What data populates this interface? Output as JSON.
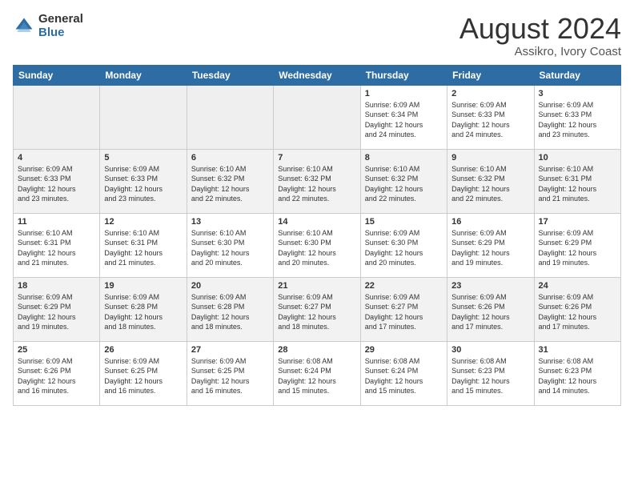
{
  "header": {
    "logo_general": "General",
    "logo_blue": "Blue",
    "month_year": "August 2024",
    "location": "Assikro, Ivory Coast"
  },
  "days_of_week": [
    "Sunday",
    "Monday",
    "Tuesday",
    "Wednesday",
    "Thursday",
    "Friday",
    "Saturday"
  ],
  "weeks": [
    [
      {
        "day": "",
        "info": ""
      },
      {
        "day": "",
        "info": ""
      },
      {
        "day": "",
        "info": ""
      },
      {
        "day": "",
        "info": ""
      },
      {
        "day": "1",
        "info": "Sunrise: 6:09 AM\nSunset: 6:34 PM\nDaylight: 12 hours\nand 24 minutes."
      },
      {
        "day": "2",
        "info": "Sunrise: 6:09 AM\nSunset: 6:33 PM\nDaylight: 12 hours\nand 24 minutes."
      },
      {
        "day": "3",
        "info": "Sunrise: 6:09 AM\nSunset: 6:33 PM\nDaylight: 12 hours\nand 23 minutes."
      }
    ],
    [
      {
        "day": "4",
        "info": "Sunrise: 6:09 AM\nSunset: 6:33 PM\nDaylight: 12 hours\nand 23 minutes."
      },
      {
        "day": "5",
        "info": "Sunrise: 6:09 AM\nSunset: 6:33 PM\nDaylight: 12 hours\nand 23 minutes."
      },
      {
        "day": "6",
        "info": "Sunrise: 6:10 AM\nSunset: 6:32 PM\nDaylight: 12 hours\nand 22 minutes."
      },
      {
        "day": "7",
        "info": "Sunrise: 6:10 AM\nSunset: 6:32 PM\nDaylight: 12 hours\nand 22 minutes."
      },
      {
        "day": "8",
        "info": "Sunrise: 6:10 AM\nSunset: 6:32 PM\nDaylight: 12 hours\nand 22 minutes."
      },
      {
        "day": "9",
        "info": "Sunrise: 6:10 AM\nSunset: 6:32 PM\nDaylight: 12 hours\nand 22 minutes."
      },
      {
        "day": "10",
        "info": "Sunrise: 6:10 AM\nSunset: 6:31 PM\nDaylight: 12 hours\nand 21 minutes."
      }
    ],
    [
      {
        "day": "11",
        "info": "Sunrise: 6:10 AM\nSunset: 6:31 PM\nDaylight: 12 hours\nand 21 minutes."
      },
      {
        "day": "12",
        "info": "Sunrise: 6:10 AM\nSunset: 6:31 PM\nDaylight: 12 hours\nand 21 minutes."
      },
      {
        "day": "13",
        "info": "Sunrise: 6:10 AM\nSunset: 6:30 PM\nDaylight: 12 hours\nand 20 minutes."
      },
      {
        "day": "14",
        "info": "Sunrise: 6:10 AM\nSunset: 6:30 PM\nDaylight: 12 hours\nand 20 minutes."
      },
      {
        "day": "15",
        "info": "Sunrise: 6:09 AM\nSunset: 6:30 PM\nDaylight: 12 hours\nand 20 minutes."
      },
      {
        "day": "16",
        "info": "Sunrise: 6:09 AM\nSunset: 6:29 PM\nDaylight: 12 hours\nand 19 minutes."
      },
      {
        "day": "17",
        "info": "Sunrise: 6:09 AM\nSunset: 6:29 PM\nDaylight: 12 hours\nand 19 minutes."
      }
    ],
    [
      {
        "day": "18",
        "info": "Sunrise: 6:09 AM\nSunset: 6:29 PM\nDaylight: 12 hours\nand 19 minutes."
      },
      {
        "day": "19",
        "info": "Sunrise: 6:09 AM\nSunset: 6:28 PM\nDaylight: 12 hours\nand 18 minutes."
      },
      {
        "day": "20",
        "info": "Sunrise: 6:09 AM\nSunset: 6:28 PM\nDaylight: 12 hours\nand 18 minutes."
      },
      {
        "day": "21",
        "info": "Sunrise: 6:09 AM\nSunset: 6:27 PM\nDaylight: 12 hours\nand 18 minutes."
      },
      {
        "day": "22",
        "info": "Sunrise: 6:09 AM\nSunset: 6:27 PM\nDaylight: 12 hours\nand 17 minutes."
      },
      {
        "day": "23",
        "info": "Sunrise: 6:09 AM\nSunset: 6:26 PM\nDaylight: 12 hours\nand 17 minutes."
      },
      {
        "day": "24",
        "info": "Sunrise: 6:09 AM\nSunset: 6:26 PM\nDaylight: 12 hours\nand 17 minutes."
      }
    ],
    [
      {
        "day": "25",
        "info": "Sunrise: 6:09 AM\nSunset: 6:26 PM\nDaylight: 12 hours\nand 16 minutes."
      },
      {
        "day": "26",
        "info": "Sunrise: 6:09 AM\nSunset: 6:25 PM\nDaylight: 12 hours\nand 16 minutes."
      },
      {
        "day": "27",
        "info": "Sunrise: 6:09 AM\nSunset: 6:25 PM\nDaylight: 12 hours\nand 16 minutes."
      },
      {
        "day": "28",
        "info": "Sunrise: 6:08 AM\nSunset: 6:24 PM\nDaylight: 12 hours\nand 15 minutes."
      },
      {
        "day": "29",
        "info": "Sunrise: 6:08 AM\nSunset: 6:24 PM\nDaylight: 12 hours\nand 15 minutes."
      },
      {
        "day": "30",
        "info": "Sunrise: 6:08 AM\nSunset: 6:23 PM\nDaylight: 12 hours\nand 15 minutes."
      },
      {
        "day": "31",
        "info": "Sunrise: 6:08 AM\nSunset: 6:23 PM\nDaylight: 12 hours\nand 14 minutes."
      }
    ]
  ]
}
